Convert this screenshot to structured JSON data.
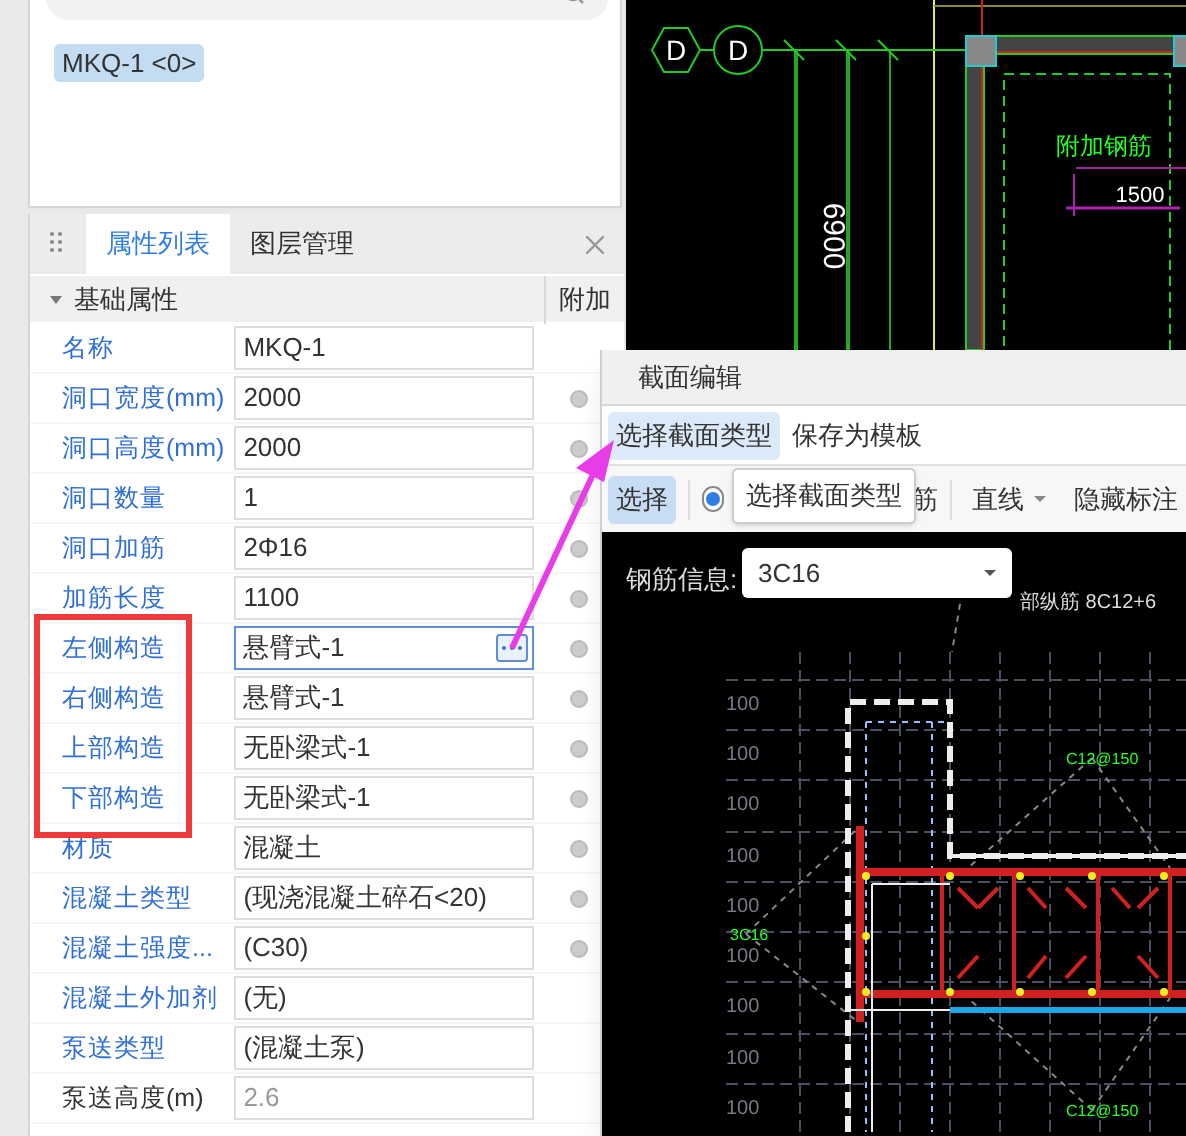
{
  "component_chips": [
    {
      "label": "MKQ-1 <0>",
      "selected": true
    }
  ],
  "panel_tabs": [
    {
      "label": "属性列表",
      "selected": true
    },
    {
      "label": "图层管理",
      "selected": false
    }
  ],
  "property_group": {
    "title": "基础属性",
    "expanded": true,
    "extra_header": "附加"
  },
  "properties": [
    {
      "name": "名称",
      "value": "MKQ-1",
      "attach_option": false,
      "highlighted": false,
      "editing": false,
      "disabled": false
    },
    {
      "name": "洞口宽度(mm)",
      "value": "2000",
      "attach_option": true,
      "highlighted": false,
      "editing": false,
      "disabled": false
    },
    {
      "name": "洞口高度(mm)",
      "value": "2000",
      "attach_option": true,
      "highlighted": false,
      "editing": false,
      "disabled": false
    },
    {
      "name": "洞口数量",
      "value": "1",
      "attach_option": true,
      "highlighted": false,
      "editing": false,
      "disabled": false
    },
    {
      "name": "洞口加筋",
      "value": "2Φ16",
      "attach_option": true,
      "highlighted": false,
      "editing": false,
      "disabled": false
    },
    {
      "name": "加筋长度",
      "value": "1100",
      "attach_option": true,
      "highlighted": false,
      "editing": false,
      "disabled": false
    },
    {
      "name": "左侧构造",
      "value": "悬臂式-1",
      "attach_option": true,
      "highlighted": true,
      "editing": true,
      "disabled": false
    },
    {
      "name": "右侧构造",
      "value": "悬臂式-1",
      "attach_option": true,
      "highlighted": true,
      "editing": false,
      "disabled": false
    },
    {
      "name": "上部构造",
      "value": "无卧梁式-1",
      "attach_option": true,
      "highlighted": true,
      "editing": false,
      "disabled": false
    },
    {
      "name": "下部构造",
      "value": "无卧梁式-1",
      "attach_option": true,
      "highlighted": true,
      "editing": false,
      "disabled": false
    },
    {
      "name": "材质",
      "value": "混凝土",
      "attach_option": true,
      "highlighted": false,
      "editing": false,
      "disabled": false
    },
    {
      "name": "混凝土类型",
      "value": "(现浇混凝土碎石<20)",
      "attach_option": true,
      "highlighted": false,
      "editing": false,
      "disabled": false
    },
    {
      "name": "混凝土强度...",
      "value": "(C30)",
      "attach_option": true,
      "highlighted": false,
      "editing": false,
      "disabled": false
    },
    {
      "name": "混凝土外加剂",
      "value": "(无)",
      "attach_option": false,
      "highlighted": false,
      "editing": false,
      "disabled": false
    },
    {
      "name": "泵送类型",
      "value": "(混凝土泵)",
      "attach_option": false,
      "highlighted": false,
      "editing": false,
      "disabled": false
    },
    {
      "name": "泵送高度(m)",
      "value": "2.6",
      "attach_option": false,
      "highlighted": false,
      "editing": false,
      "disabled": true
    }
  ],
  "plan": {
    "axis_labels": [
      "D",
      "D"
    ],
    "dimension": "6900",
    "room_label": "附加钢筋",
    "width_dim": "1500"
  },
  "dialog": {
    "title": "截面编辑",
    "menu": [
      {
        "label": "选择截面类型",
        "selected": true
      },
      {
        "label": "保存为模板",
        "selected": false
      }
    ],
    "toolbar": [
      {
        "kind": "button",
        "label": "选择",
        "selected": true
      },
      {
        "kind": "radio",
        "checked": true
      },
      {
        "kind": "text",
        "label": "筋"
      },
      {
        "kind": "dropdown",
        "label": "直线"
      },
      {
        "kind": "button",
        "label": "隐藏标注",
        "selected": false
      }
    ],
    "tooltip": "选择截面类型",
    "rebar_label": "钢筋信息:",
    "rebar_value": "3C16",
    "note": "部纵筋 8C12+6",
    "grid_labels": [
      "100",
      "100",
      "100",
      "100",
      "100",
      "100",
      "100",
      "100",
      "100"
    ],
    "annotations": [
      "C12@150",
      "3C16",
      "C12@150"
    ]
  }
}
